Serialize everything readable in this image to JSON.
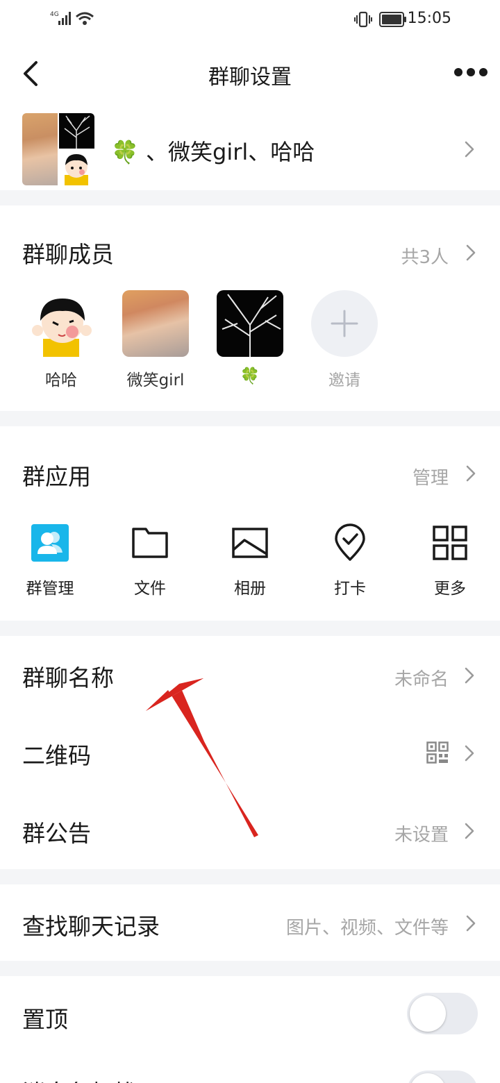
{
  "status_bar": {
    "network": "4G",
    "time": "15:05"
  },
  "header": {
    "title": "群聊设置"
  },
  "group": {
    "display_name": "🍀 、微笑girl、哈哈"
  },
  "members_section": {
    "title": "群聊成员",
    "count": "共3人",
    "members": [
      {
        "name": "哈哈"
      },
      {
        "name": "微笑girl"
      },
      {
        "name": "🍀"
      }
    ],
    "invite_label": "邀请"
  },
  "apps_section": {
    "title": "群应用",
    "manage_label": "管理",
    "apps": [
      {
        "label": "群管理",
        "icon": "group-manage-icon",
        "color": "#19b6ea"
      },
      {
        "label": "文件",
        "icon": "folder-icon"
      },
      {
        "label": "相册",
        "icon": "photo-album-icon"
      },
      {
        "label": "打卡",
        "icon": "checkin-icon"
      },
      {
        "label": "更多",
        "icon": "grid-more-icon"
      }
    ]
  },
  "settings": {
    "group_name": {
      "label": "群聊名称",
      "value": "未命名"
    },
    "qr_code": {
      "label": "二维码",
      "icon": "qr-code-icon"
    },
    "announcement": {
      "label": "群公告",
      "value": "未设置"
    }
  },
  "search_history": {
    "label": "查找聊天记录",
    "hint": "图片、视频、文件等"
  },
  "toggles": {
    "pin": {
      "label": "置顶",
      "on": false
    },
    "second": {
      "label": "消息免打扰",
      "on": false
    }
  },
  "colors": {
    "annotation_arrow": "#d9251f",
    "hint_text": "#a6a6a6",
    "divider": "#f4f5f7"
  }
}
